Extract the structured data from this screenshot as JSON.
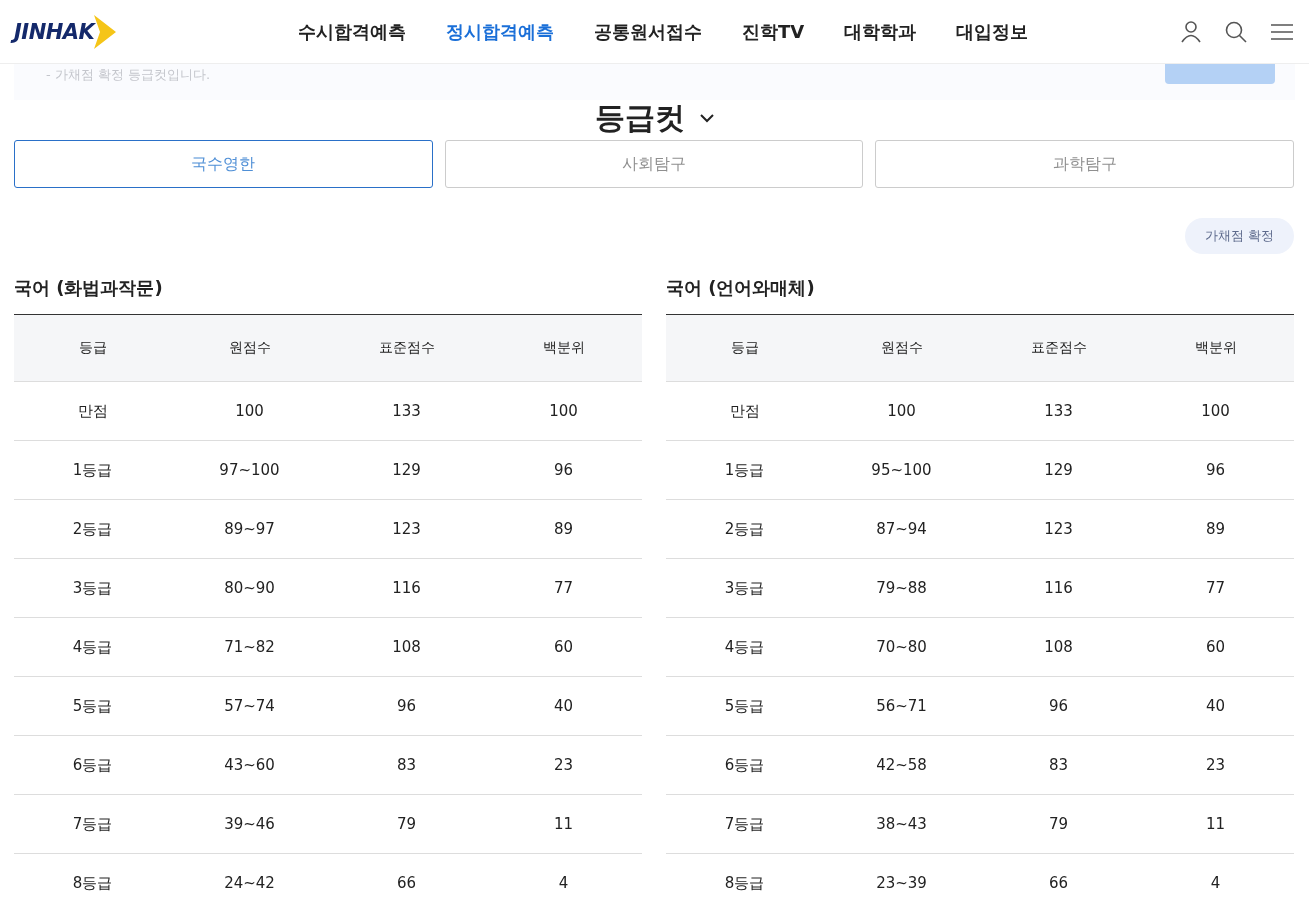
{
  "header": {
    "logo": "JINHAK",
    "nav": [
      {
        "label": "수시합격예측",
        "selected": false
      },
      {
        "label": "정시합격예측",
        "selected": true
      },
      {
        "label": "공통원서접수",
        "selected": false
      },
      {
        "label": "진학TV",
        "selected": false
      },
      {
        "label": "대학학과",
        "selected": false
      },
      {
        "label": "대입정보",
        "selected": false
      }
    ]
  },
  "notice": {
    "text": "- 가채점 확정 등급컷입니다."
  },
  "title": "등급컷",
  "tabs": [
    {
      "label": "국수영한",
      "selected": true
    },
    {
      "label": "사회탐구",
      "selected": false
    },
    {
      "label": "과학탐구",
      "selected": false
    }
  ],
  "filter_button": "가채점 확정",
  "tables": [
    {
      "title": "국어 (화법과작문)",
      "columns": [
        "등급",
        "원점수",
        "표준점수",
        "백분위"
      ],
      "rows": [
        [
          "만점",
          "100",
          "133",
          "100"
        ],
        [
          "1등급",
          "97~100",
          "129",
          "96"
        ],
        [
          "2등급",
          "89~97",
          "123",
          "89"
        ],
        [
          "3등급",
          "80~90",
          "116",
          "77"
        ],
        [
          "4등급",
          "71~82",
          "108",
          "60"
        ],
        [
          "5등급",
          "57~74",
          "96",
          "40"
        ],
        [
          "6등급",
          "43~60",
          "83",
          "23"
        ],
        [
          "7등급",
          "39~46",
          "79",
          "11"
        ],
        [
          "8등급",
          "24~42",
          "66",
          "4"
        ]
      ]
    },
    {
      "title": "국어 (언어와매체)",
      "columns": [
        "등급",
        "원점수",
        "표준점수",
        "백분위"
      ],
      "rows": [
        [
          "만점",
          "100",
          "133",
          "100"
        ],
        [
          "1등급",
          "95~100",
          "129",
          "96"
        ],
        [
          "2등급",
          "87~94",
          "123",
          "89"
        ],
        [
          "3등급",
          "79~88",
          "116",
          "77"
        ],
        [
          "4등급",
          "70~80",
          "108",
          "60"
        ],
        [
          "5등급",
          "56~71",
          "96",
          "40"
        ],
        [
          "6등급",
          "42~58",
          "83",
          "23"
        ],
        [
          "7등급",
          "38~43",
          "79",
          "11"
        ],
        [
          "8등급",
          "23~39",
          "66",
          "4"
        ]
      ]
    }
  ]
}
